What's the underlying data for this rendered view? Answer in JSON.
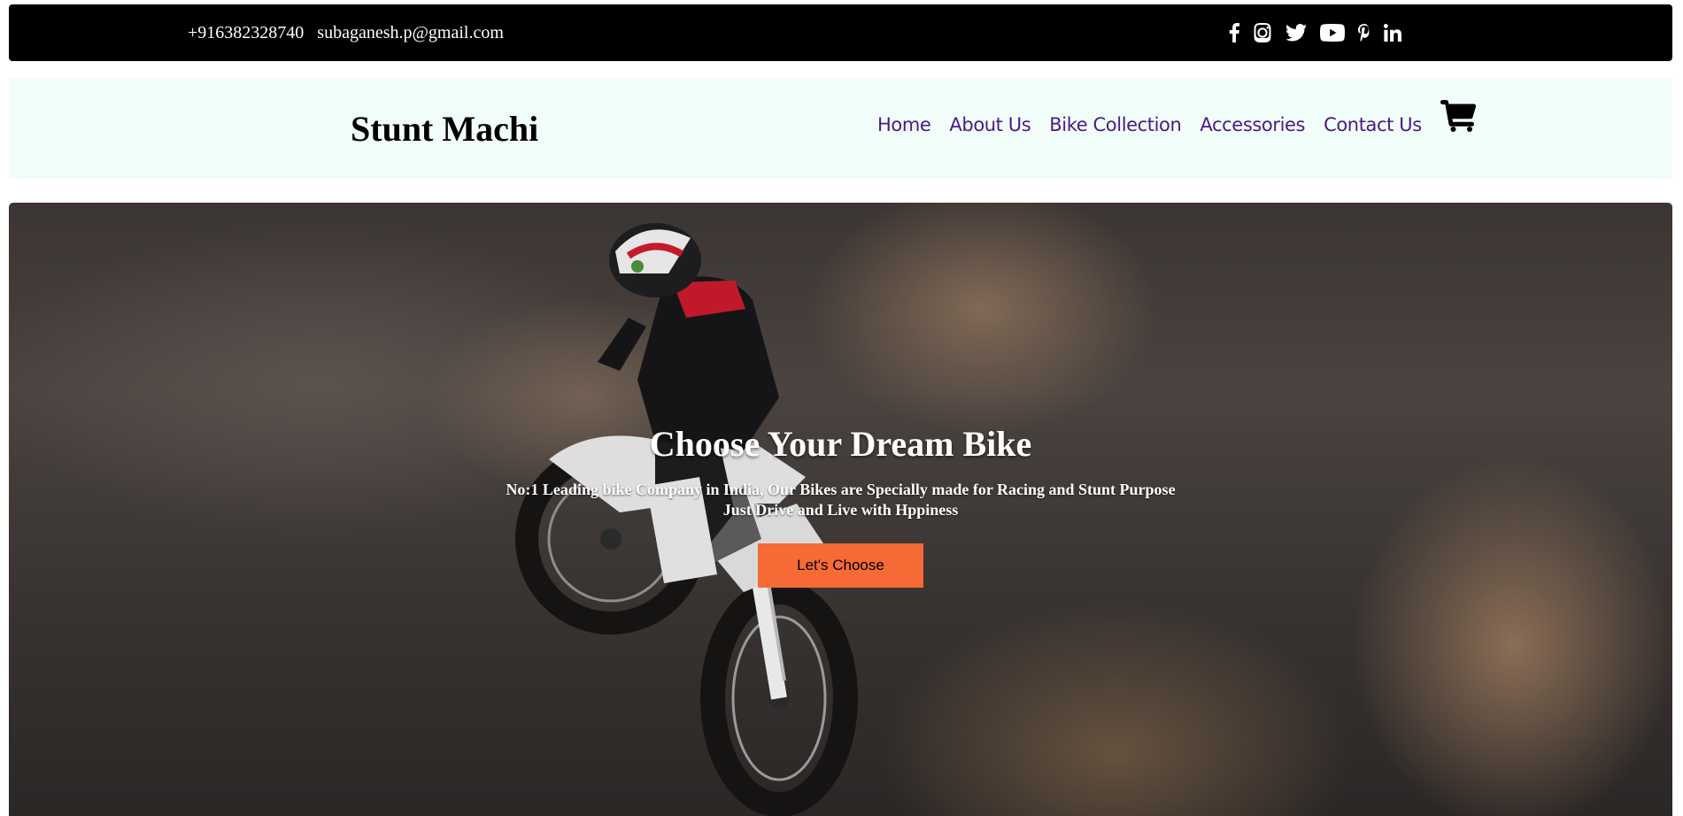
{
  "topbar": {
    "phone": "+916382328740",
    "email": "subaganesh.p@gmail.com",
    "social_icons": [
      "facebook-icon",
      "instagram-icon",
      "twitter-icon",
      "youtube-icon",
      "pinterest-icon",
      "linkedin-icon"
    ]
  },
  "navbar": {
    "brand": "Stunt Machi",
    "links": [
      "Home",
      "About Us",
      "Bike Collection",
      "Accessories",
      "Contact Us"
    ],
    "cart_icon": "cart-icon"
  },
  "hero": {
    "title": "Choose Your Dream Bike",
    "subtitle_line1": "No:1 Leading bike Company in India, Our Bikes are Specially made for Racing and Stunt Purpose",
    "subtitle_line2": "Just Drive and Live with Hppiness",
    "cta_label": "Let's Choose"
  },
  "colors": {
    "topbar_bg": "#000000",
    "navbar_bg": "#f1fdf8",
    "nav_link": "#4a1a85",
    "cta_bg": "#f56a35"
  }
}
